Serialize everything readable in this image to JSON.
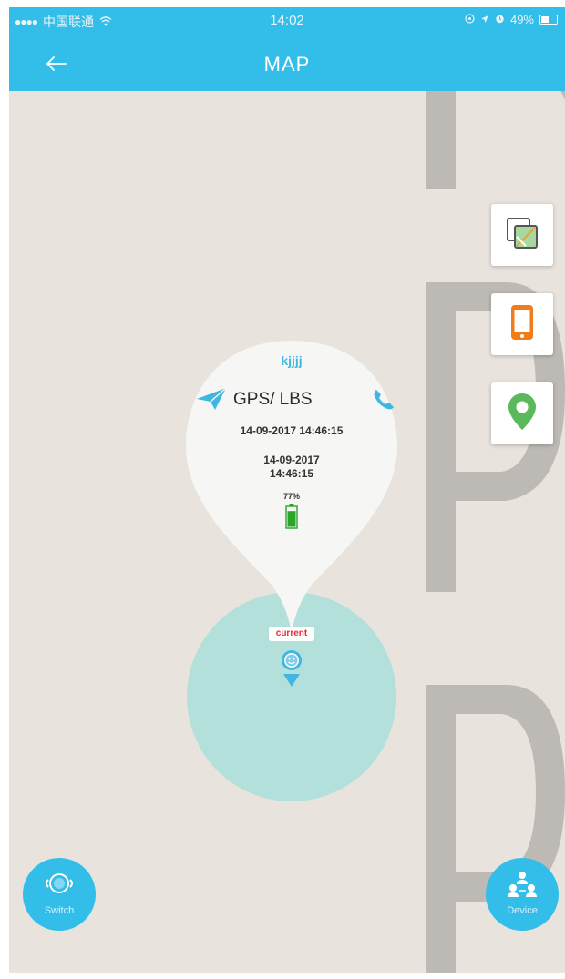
{
  "status_bar": {
    "signal": "●●●●",
    "carrier": "中国联通",
    "time": "14:02",
    "battery": "49%"
  },
  "nav": {
    "title": "MAP",
    "back_icon": "arrow-left-icon"
  },
  "side_buttons": [
    {
      "name": "map-layers-button",
      "icon": "layers-icon"
    },
    {
      "name": "device-location-button",
      "icon": "phone-icon"
    },
    {
      "name": "my-location-button",
      "icon": "location-pin-icon"
    }
  ],
  "info_bubble": {
    "device_name": "kjjjj",
    "mode": "GPS/ LBS",
    "time_1": "14-09-2017 14:46:15",
    "time_2": "14-09-2017 14:46:15",
    "battery": "77%",
    "battery_level": 0.77
  },
  "marker": {
    "badge": "current"
  },
  "fab_left": {
    "label": "Switch",
    "icon": "switch-watch-icon"
  },
  "fab_right": {
    "label": "Device",
    "icon": "device-group-icon"
  },
  "colors": {
    "header": "#33bde9",
    "map_background": "#e8e3dc",
    "accuracy_circle": "#b3e0db",
    "accent": "#3fb7e2",
    "battery_green": "#2aa52a",
    "badge_text": "#e62a3a",
    "pin_green": "#5cb85c",
    "phone_orange": "#f07d1a"
  }
}
